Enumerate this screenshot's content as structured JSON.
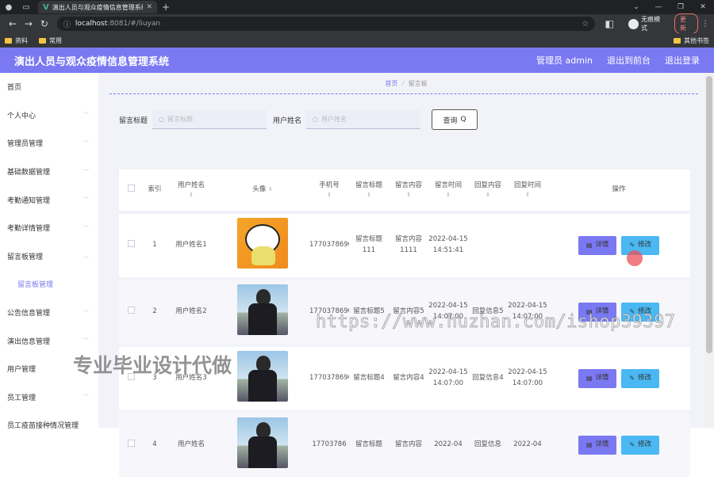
{
  "browser": {
    "tab_title": "演出人员与观众疫情信息管理系统",
    "url_host": "localhost",
    "url_path": ":8081/#/liuyan",
    "incognito_label": "无痕模式",
    "update_label": "更新",
    "bookmarks": [
      "资料",
      "常用"
    ],
    "bookmarks_right": "其他书签"
  },
  "app": {
    "title": "演出人员与观众疫情信息管理系统",
    "user_label": "管理员 admin",
    "front_label": "退出到前台",
    "logout_label": "退出登录",
    "accent": "#7a79f2"
  },
  "sidebar": {
    "items": [
      {
        "label": "首页"
      },
      {
        "label": "个人中心"
      },
      {
        "label": "管理员管理"
      },
      {
        "label": "基础数据管理"
      },
      {
        "label": "考勤通知管理"
      },
      {
        "label": "考勤详情管理"
      },
      {
        "label": "留言板管理"
      },
      {
        "label": "留言板管理"
      },
      {
        "label": "公告信息管理"
      },
      {
        "label": "演出信息管理"
      },
      {
        "label": "用户管理"
      },
      {
        "label": "员工管理"
      },
      {
        "label": "员工疫苗接种情况管理"
      }
    ]
  },
  "breadcrumb": {
    "home": "首页",
    "current": "留言板"
  },
  "search": {
    "title_label": "留言标题",
    "title_placeholder": "留言标题",
    "name_label": "用户姓名",
    "name_placeholder": "用户姓名",
    "button_label": "查询"
  },
  "table": {
    "headers": {
      "index": "索引",
      "name": "用户姓名",
      "avatar": "头像",
      "phone": "手机号",
      "msg_title": "留言标题",
      "msg_content": "留言内容",
      "msg_time": "留言时间",
      "reply_content": "回复内容",
      "reply_time": "回复时间",
      "ops": "操作"
    },
    "rows": [
      {
        "index": "1",
        "name": "用户姓名1",
        "phone": "17703786901",
        "title": "留言标题111",
        "content": "留言内容1111",
        "time": "2022-04-15 14:51:41",
        "reply": "",
        "reply_time": ""
      },
      {
        "index": "2",
        "name": "用户姓名2",
        "phone": "17703786902",
        "title": "留言标题5",
        "content": "留言内容5",
        "time": "2022-04-15 14:07:00",
        "reply": "回复信息5",
        "reply_time": "2022-04-15 14:07:00"
      },
      {
        "index": "3",
        "name": "用户姓名3",
        "phone": "17703786903",
        "title": "留言标题4",
        "content": "留言内容4",
        "time": "2022-04-15 14:07:00",
        "reply": "回复信息4",
        "reply_time": "2022-04-15 14:07:00"
      },
      {
        "index": "4",
        "name": "用户姓名",
        "phone": "17703786",
        "title": "留言标题",
        "content": "留言内容",
        "time": "2022-04",
        "reply": "回复信息",
        "reply_time": "2022-04"
      }
    ],
    "detail_label": "详情",
    "edit_label": "修改"
  },
  "watermarks": {
    "url": "https://www.huzhan.com/ishop39397",
    "text": "专业毕业设计代做"
  }
}
